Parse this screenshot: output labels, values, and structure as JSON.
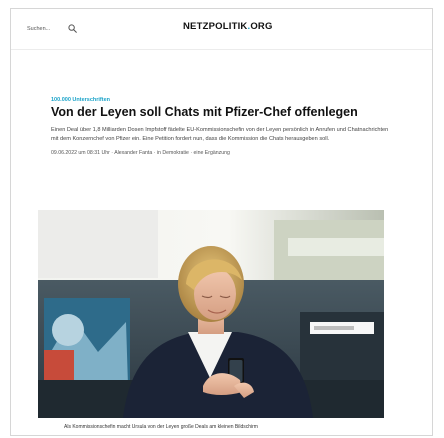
{
  "header": {
    "search_label": "Suchen...",
    "logo_main": "NETZPOLITIK",
    "logo_dot": ".",
    "logo_tld": "ORG",
    "logo_dot_color": "#1aa3c9"
  },
  "article": {
    "kicker": "100.000 Unterschriften",
    "headline": "Von der Leyen soll Chats mit Pfizer-Chef offenlegen",
    "teaser": "Einen Deal über 1,8 Milliarden Dosen Impfstoff fädelte EU-Kommissionschefin von der Leyen persönlich in Anrufen und Chatnachrichten mit dem Konzernchef von Pfizer ein. Eine Petition fordert nun, dass die Kommission die Chats herausgeben soll.",
    "meta": {
      "date": "09.06.2022 um 08:31 Uhr",
      "author": "Alexander Fanta",
      "category": "in Demokratie",
      "note": "eine Ergänzung"
    }
  },
  "image": {
    "caption": "Als Kommissionschefin macht Ursula von der Leyen große Deals am kleinen Bildschirm"
  },
  "icons": {
    "search": "search-icon"
  }
}
